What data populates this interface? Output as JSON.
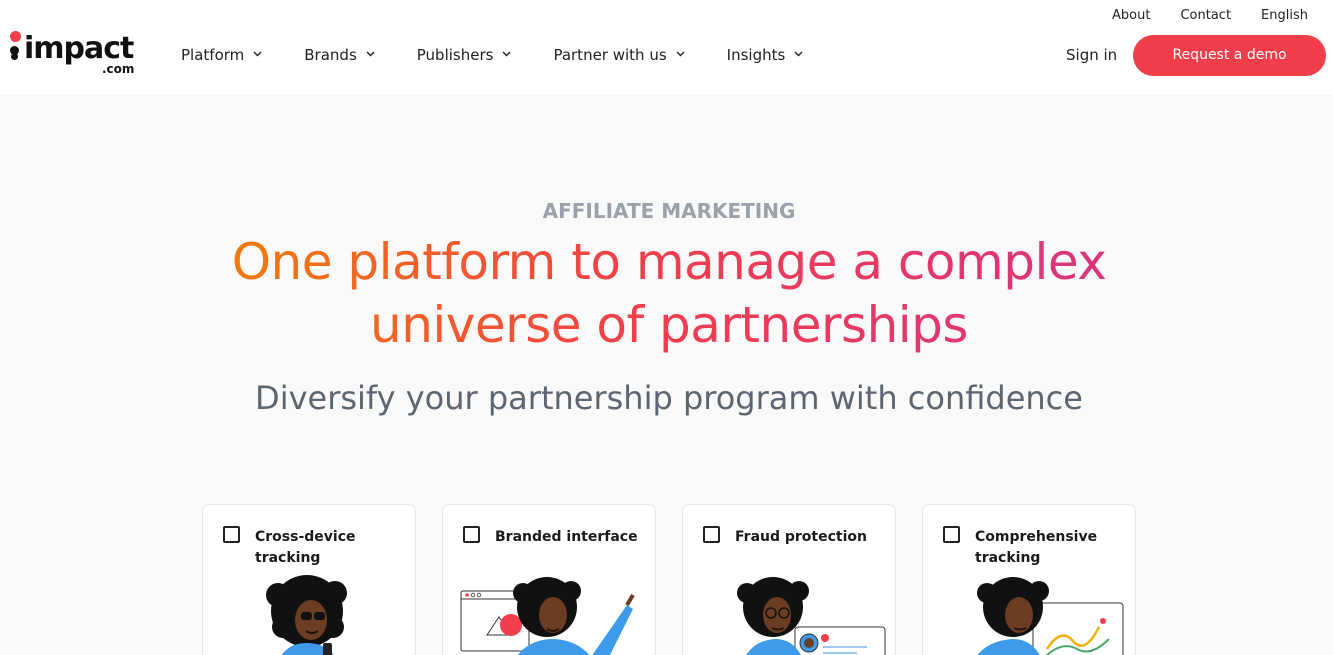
{
  "utility_nav": [
    "About",
    "Contact",
    "English"
  ],
  "logo": {
    "word": "impact",
    "suffix": ".com"
  },
  "main_nav": [
    {
      "label": "Platform"
    },
    {
      "label": "Brands"
    },
    {
      "label": "Publishers"
    },
    {
      "label": "Partner with us"
    },
    {
      "label": "Insights"
    }
  ],
  "header_actions": {
    "sign_in": "Sign in",
    "demo": "Request a demo"
  },
  "hero": {
    "eyebrow": "AFFILIATE MARKETING",
    "headline_line1": "One platform to manage a complex",
    "headline_line2": "universe of partnerships",
    "subhead": "Diversify your partnership program with confidence"
  },
  "features": [
    {
      "label": "Cross-device tracking",
      "checked": false
    },
    {
      "label": "Branded interface",
      "checked": false
    },
    {
      "label": "Fraud protection",
      "checked": false
    },
    {
      "label": "Comprehensive tracking",
      "checked": false
    }
  ],
  "colors": {
    "accent": "#f23d4b",
    "gradient_start": "#f1790d",
    "gradient_end": "#d9347e",
    "eyebrow": "#9aa1a9",
    "subhead": "#5d6571",
    "illustration_shirt": "#3d9be9",
    "illustration_skin": "#6b3d22"
  }
}
